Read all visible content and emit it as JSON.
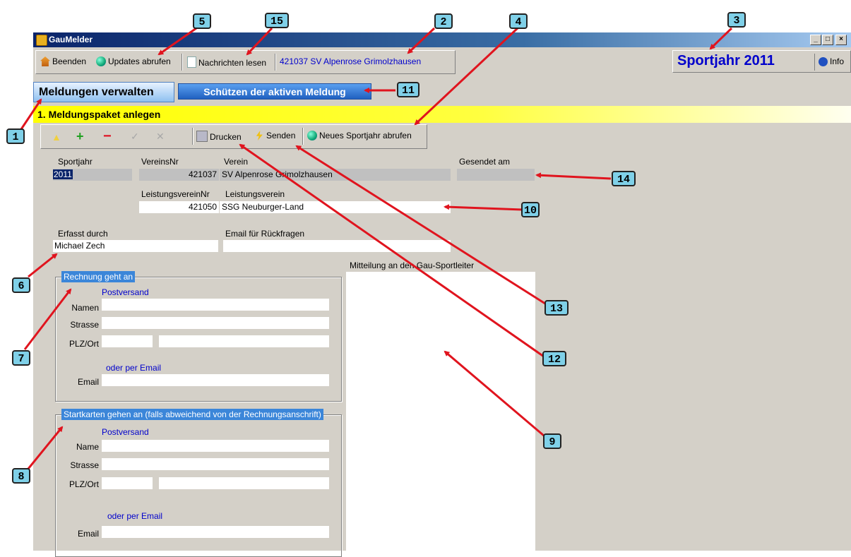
{
  "window": {
    "title": "GauMelder",
    "minimize": "_",
    "maximize": "□",
    "close": "×"
  },
  "toolbar": {
    "exit_label": "Beenden",
    "updates_label": "Updates abrufen",
    "messages_label": "Nachrichten lesen",
    "club_display": "421037  SV Alpenrose Grimolzhausen"
  },
  "header": {
    "sport_year": "Sportjahr 2011",
    "info_label": "Info"
  },
  "tabs": [
    {
      "label": "Meldungen verwalten"
    },
    {
      "label": "Schützen der aktiven Meldung"
    }
  ],
  "section": {
    "title": "1. Meldungspaket anlegen"
  },
  "actions": {
    "print_label": "Drucken",
    "send_label": "Senden",
    "new_year_label": "Neues Sportjahr abrufen"
  },
  "form": {
    "sportjahr_label": "Sportjahr",
    "sportjahr_value": "2011",
    "vereinsnr_label": "VereinsNr",
    "vereinsnr_value": "421037",
    "verein_label": "Verein",
    "verein_value": "SV Alpenrose Grimolzhausen",
    "gesendet_label": "Gesendet am",
    "gesendet_value": "",
    "leistungsvereinnr_label": "LeistungsvereinNr",
    "leistungsvereinnr_value": "421050",
    "leistungsverein_label": "Leistungsverein",
    "leistungsverein_value": "SSG Neuburger-Land",
    "erfasst_label": "Erfasst durch",
    "erfasst_value": "Michael Zech",
    "email_rueck_label": "Email für Rückfragen",
    "email_rueck_value": "",
    "mitteilung_label": "Mitteilung an den Gau-Sportleiter"
  },
  "rechnung": {
    "legend": "Rechnung geht an",
    "postversand": "Postversand",
    "name_label": "Namen",
    "strasse_label": "Strasse",
    "plz_label": "PLZ/Ort",
    "oder_email": "oder per Email",
    "email_label": "Email"
  },
  "startkarten": {
    "legend": "Startkarten gehen an (falls abweichend von der Rechnungsanschrift)",
    "postversand": "Postversand",
    "name_label": "Name",
    "strasse_label": "Strasse",
    "plz_label": "PLZ/Ort",
    "oder_email": "oder per Email",
    "email_label": "Email"
  },
  "callouts": [
    "1",
    "2",
    "3",
    "4",
    "5",
    "6",
    "7",
    "8",
    "9",
    "10",
    "11",
    "12",
    "13",
    "14",
    "15"
  ],
  "colors": {
    "callout_bg": "#7fd0e8",
    "arrow": "#e0141e",
    "section_bar": "#ffff00",
    "tab_active": "#8ec0f0",
    "tab_inactive": "#2060c0",
    "sport_year": "#0000cc"
  }
}
